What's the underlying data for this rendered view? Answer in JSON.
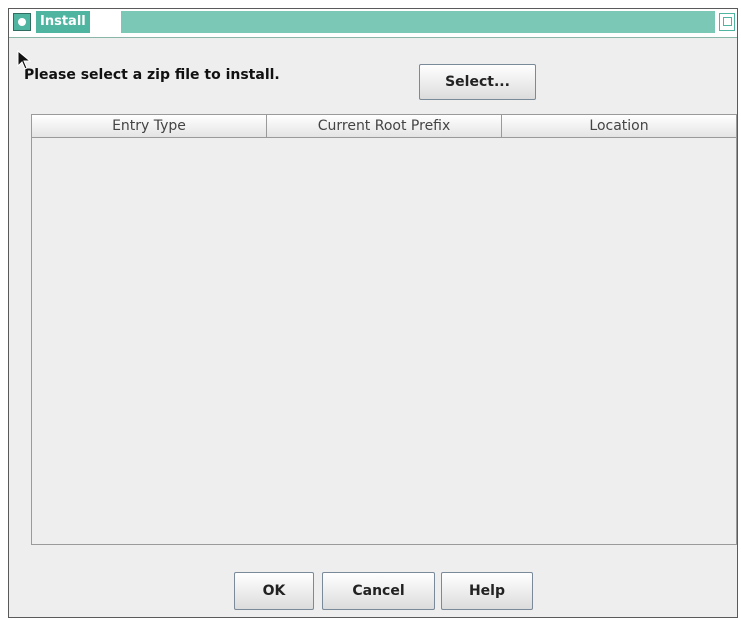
{
  "window": {
    "title": "Install"
  },
  "prompt": {
    "text": "Please select a zip file to install."
  },
  "select_button": {
    "label": "Select..."
  },
  "table": {
    "columns": [
      "Entry Type",
      "Current Root Prefix",
      "Location"
    ],
    "rows": []
  },
  "footer": {
    "ok_label": "OK",
    "cancel_label": "Cancel",
    "help_label": "Help"
  },
  "icons": {
    "title": "window-icon",
    "maximize": "maximize-icon",
    "cursor": "mouse-cursor-icon"
  },
  "colors": {
    "titlebar_accent": "#4fb5a1",
    "titlebar_fill": "#7cc8b6",
    "dialog_background": "#eeeeee"
  }
}
